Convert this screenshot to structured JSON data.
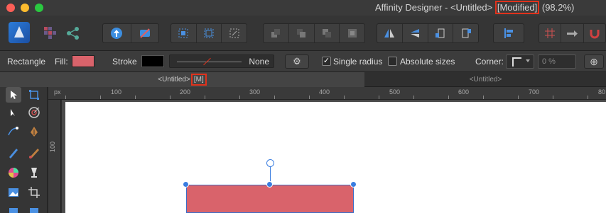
{
  "window": {
    "title_prefix": "Affinity Designer - <Untitled>",
    "title_modified": "[Modified]",
    "title_zoom": "(98.2%)"
  },
  "context_toolbar": {
    "tool_name": "Rectangle",
    "fill_label": "Fill:",
    "fill_color": "#d9636b",
    "stroke_label": "Stroke",
    "stroke_color": "#000000",
    "stroke_width_value": "None",
    "single_radius_label": "Single radius",
    "single_radius_checked": true,
    "absolute_sizes_label": "Absolute sizes",
    "absolute_sizes_checked": false,
    "corner_label": "Corner:",
    "corner_percent": "0 %"
  },
  "tabs": [
    {
      "label": "<Untitled>",
      "badge": "[M]",
      "active": true
    },
    {
      "label": "<Untitled>",
      "badge": "",
      "active": false
    }
  ],
  "rulers": {
    "unit": "px",
    "top_labels": [
      "100",
      "200",
      "300",
      "400",
      "500",
      "600",
      "700",
      "80"
    ],
    "left_labels": [
      "100"
    ]
  },
  "shape": {
    "fill_color": "#d9636b"
  }
}
